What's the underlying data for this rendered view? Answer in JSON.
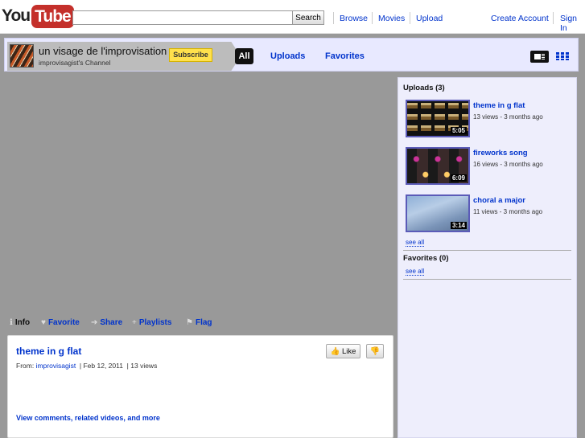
{
  "logo": {
    "you": "You",
    "tube": "Tube"
  },
  "search": {
    "placeholder": "",
    "button_label": "Search"
  },
  "topnav": {
    "browse": "Browse",
    "movies": "Movies",
    "upload": "Upload",
    "create_account": "Create Account",
    "sign_in": "Sign In"
  },
  "channel": {
    "title": "un visage de l'improvisation",
    "subtitle": "improvisagist's Channel",
    "subscribe_label": "Subscribe",
    "tabs": [
      "All",
      "Uploads",
      "Favorites"
    ]
  },
  "actions": {
    "info": "Info",
    "favorite": "Favorite",
    "share": "Share",
    "playlists": "Playlists",
    "flag": "Flag"
  },
  "video": {
    "title": "theme in g flat",
    "from_label": "From:",
    "author": "improvisagist",
    "date": "Feb 12, 2011",
    "views": "13 views",
    "like_label": "Like",
    "more_link": "View comments, related videos, and more"
  },
  "sidebar": {
    "uploads_heading": "Uploads (3)",
    "uploads": [
      {
        "title": "theme in g flat",
        "meta": "13 views - 3 months ago",
        "duration": "5:05"
      },
      {
        "title": "fireworks song",
        "meta": "16 views - 3 months ago",
        "duration": "6:09"
      },
      {
        "title": "choral a major",
        "meta": "11 views - 3 months ago",
        "duration": "3:14"
      }
    ],
    "see_all": "see all",
    "favorites_heading": "Favorites (0)",
    "favorites_see_all": "see all"
  },
  "colors": {
    "link": "#0033cc",
    "subscribe": "#ffe14c",
    "brand": "#c4302b",
    "stage": "#999999"
  }
}
